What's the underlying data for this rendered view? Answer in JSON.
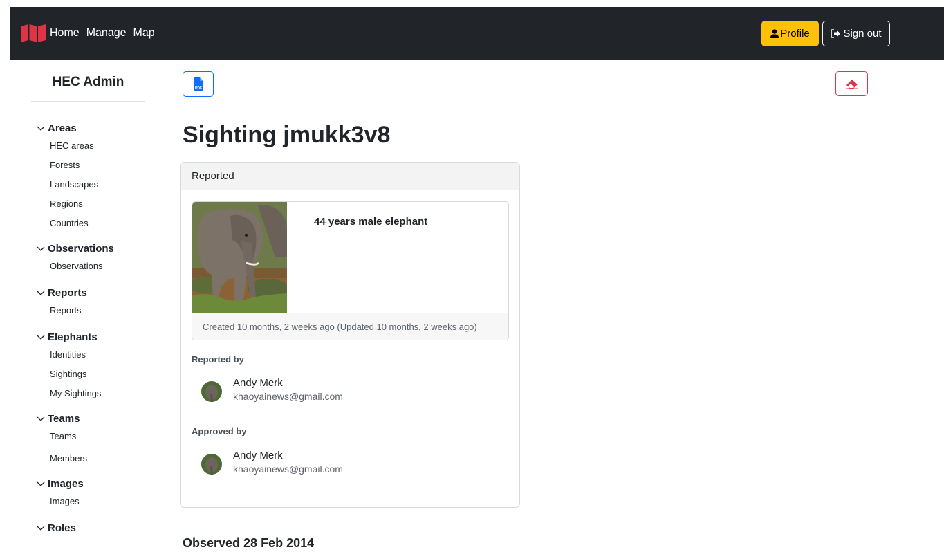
{
  "topbar": {
    "nav": [
      "Home",
      "Manage",
      "Map"
    ],
    "profile_label": "Profile",
    "signout_label": "Sign out",
    "profile_color": "#ffc107",
    "bg_color": "#212529"
  },
  "sidebar": {
    "title": "HEC Admin",
    "groups": [
      {
        "label": "Areas",
        "items": [
          "HEC areas",
          "Forests",
          "Landscapes",
          "Regions",
          "Countries"
        ]
      },
      {
        "label": "Observations",
        "items": [
          "Observations"
        ]
      },
      {
        "label": "Reports",
        "items": [
          "Reports"
        ]
      },
      {
        "label": "Elephants",
        "items": [
          "Identities",
          "Sightings",
          "My Sightings"
        ]
      },
      {
        "label": "Teams",
        "items": [
          "Teams",
          "Members"
        ]
      },
      {
        "label": "Images",
        "items": [
          "Images"
        ]
      },
      {
        "label": "Roles",
        "items": []
      }
    ]
  },
  "main": {
    "title": "Sighting jmukk3v8",
    "card_header": "Reported",
    "elephant_label": "44 years male elephant",
    "created_text": "Created 10 months, 2 weeks ago (Updated 10 months, 2 weeks ago)",
    "reported_by_label": "Reported by",
    "reporter": {
      "name": "Andy Merk",
      "email": "khaoyainews@gmail.com"
    },
    "approved_by_label": "Approved by",
    "approver": {
      "name": "Andy Merk",
      "email": "khaoyainews@gmail.com"
    },
    "observed": "Observed 28 Feb 2014"
  },
  "icons": {
    "pdf": "file-pdf-icon",
    "eraser": "eraser-icon",
    "profile": "user-icon",
    "signout": "sign-out-icon"
  }
}
